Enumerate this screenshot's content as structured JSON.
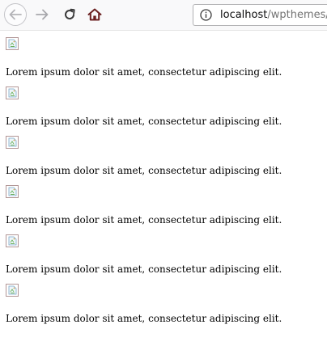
{
  "browser": {
    "url_host": "localhost",
    "url_path": "/wpthemes/"
  },
  "icons": {
    "back": "arrow-left-icon",
    "forward": "arrow-right-icon",
    "reload": "reload-icon",
    "home": "home-icon",
    "site_info": "info-icon",
    "broken_image": "broken-image-icon"
  },
  "colors": {
    "toolbar_bg": "#f9f9fa",
    "home_icon": "#6b2020",
    "url_path": "#737373"
  },
  "items": [
    {
      "text": "Lorem ipsum dolor sit amet, consectetur adipiscing elit."
    },
    {
      "text": "Lorem ipsum dolor sit amet, consectetur adipiscing elit."
    },
    {
      "text": "Lorem ipsum dolor sit amet, consectetur adipiscing elit."
    },
    {
      "text": "Lorem ipsum dolor sit amet, consectetur adipiscing elit."
    },
    {
      "text": "Lorem ipsum dolor sit amet, consectetur adipiscing elit."
    },
    {
      "text": "Lorem ipsum dolor sit amet, consectetur adipiscing elit."
    }
  ]
}
